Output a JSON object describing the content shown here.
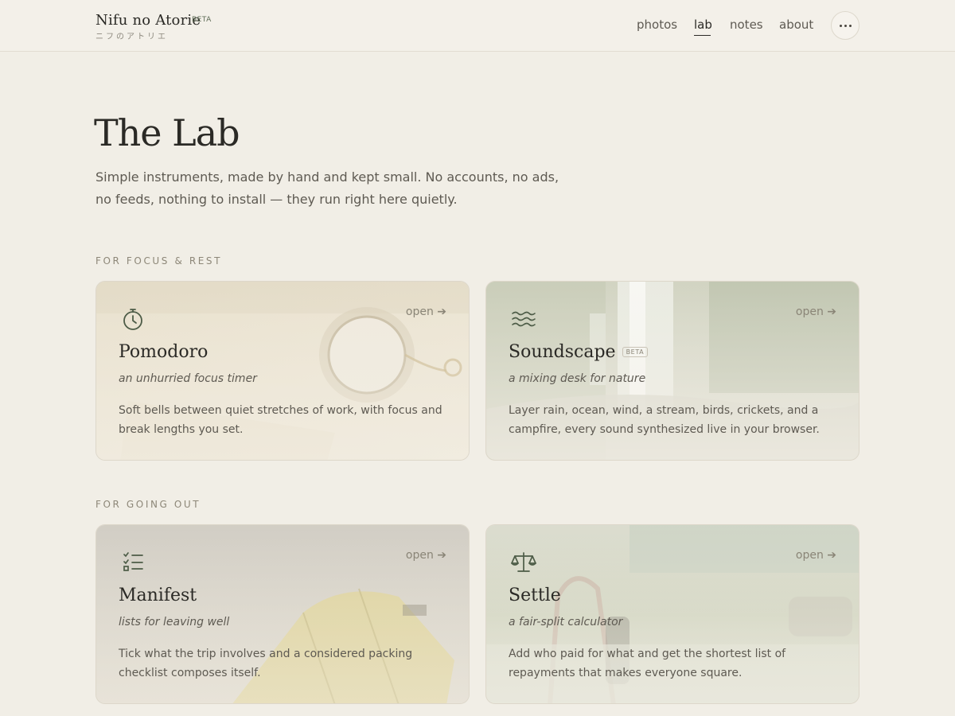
{
  "brand": {
    "name": "Nifu no Atorie",
    "beta": "BETA",
    "subtitle": "ニフのアトリエ"
  },
  "nav": {
    "items": [
      {
        "label": "photos",
        "active": false
      },
      {
        "label": "lab",
        "active": true
      },
      {
        "label": "notes",
        "active": false
      },
      {
        "label": "about",
        "active": false
      }
    ],
    "more_icon": "more-dots-icon"
  },
  "page": {
    "title": "The Lab",
    "lede": "Simple instruments, made by hand and kept small. No accounts, no ads, no feeds, nothing to install — they run right here quietly."
  },
  "sections": [
    {
      "label": "FOR FOCUS & REST",
      "cards": [
        {
          "title": "Pomodoro",
          "badge": "",
          "open": "open ➔",
          "icon": "stopwatch-icon",
          "tagline": "an unhurried focus timer",
          "description": "Soft bells between quiet stretches of work, with focus and break lengths you set."
        },
        {
          "title": "Soundscape",
          "badge": "BETA",
          "open": "open ➔",
          "icon": "waves-icon",
          "tagline": "a mixing desk for nature",
          "description": "Layer rain, ocean, wind, a stream, birds, crickets, and a campfire, every sound synthesized live in your browser."
        }
      ]
    },
    {
      "label": "FOR GOING OUT",
      "cards": [
        {
          "title": "Manifest",
          "badge": "",
          "open": "open ➔",
          "icon": "checklist-icon",
          "tagline": "lists for leaving well",
          "description": "Tick what the trip involves and a considered packing checklist composes itself."
        },
        {
          "title": "Settle",
          "badge": "",
          "open": "open ➔",
          "icon": "scales-icon",
          "tagline": "a fair-split calculator",
          "description": "Add who paid for what and get the shortest list of repayments that makes everyone square."
        }
      ]
    }
  ],
  "colors": {
    "background": "#f1eee6",
    "accent": "#4d5c47",
    "text": "#2b2a26",
    "muted": "#5e5a52"
  }
}
